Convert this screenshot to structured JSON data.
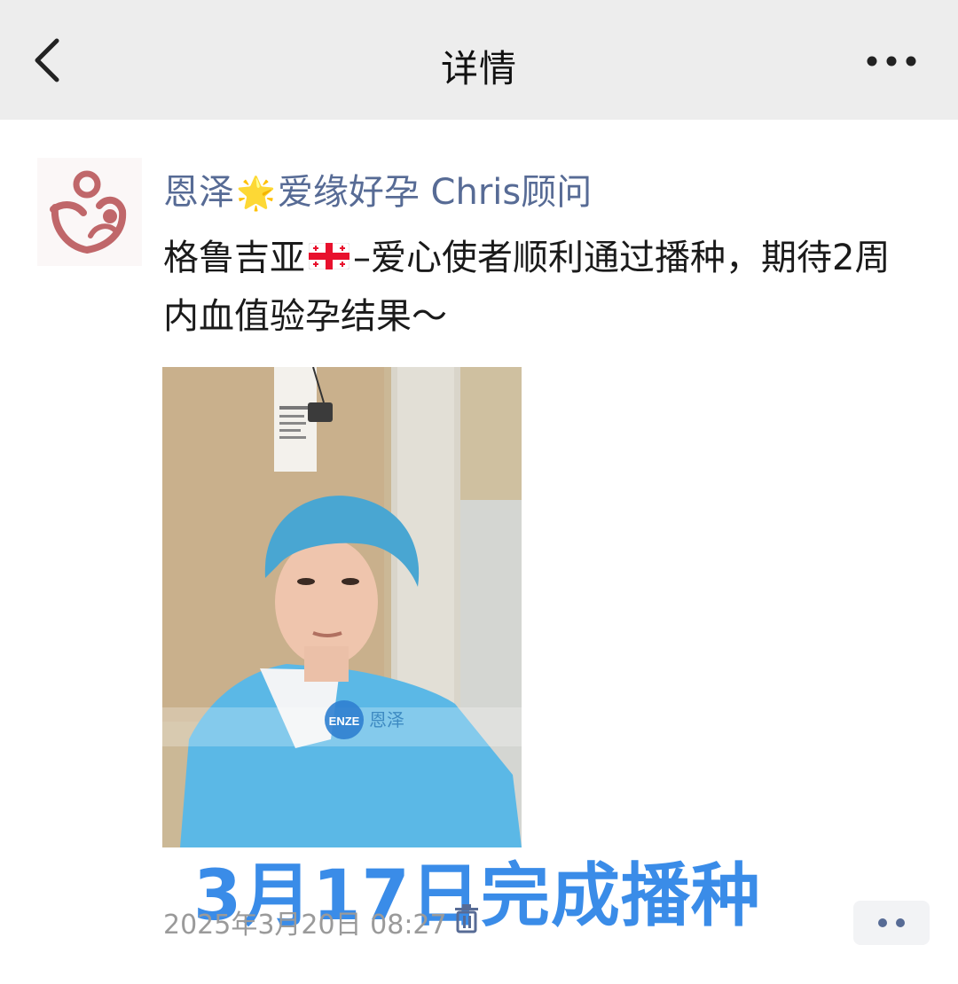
{
  "header": {
    "title": "详情",
    "back_icon": "chevron-left-icon",
    "more_icon": "more-dots-icon"
  },
  "post": {
    "nickname_prefix": "恩泽",
    "nickname_emoji": "🌟",
    "nickname_suffix": "爱缘好孕 Chris顾问",
    "content_before_flag": "格鲁吉亚",
    "flag": "georgia-flag-icon",
    "content_after_flag": "–爱心使者顺利通过播种，期待2周内血值验孕结果～",
    "photo": {
      "watermark_logo": "ENZE",
      "watermark_text": "恩泽"
    },
    "caption": "3月17日完成播种",
    "timestamp": "2025年3月20日 08:27",
    "delete_icon": "trash-icon",
    "action_icon": "comment-dots-icon"
  },
  "colors": {
    "header_bg": "#ededed",
    "nickname": "#576b95",
    "caption": "#3a8ce8",
    "timestamp": "#9a9a9a"
  }
}
